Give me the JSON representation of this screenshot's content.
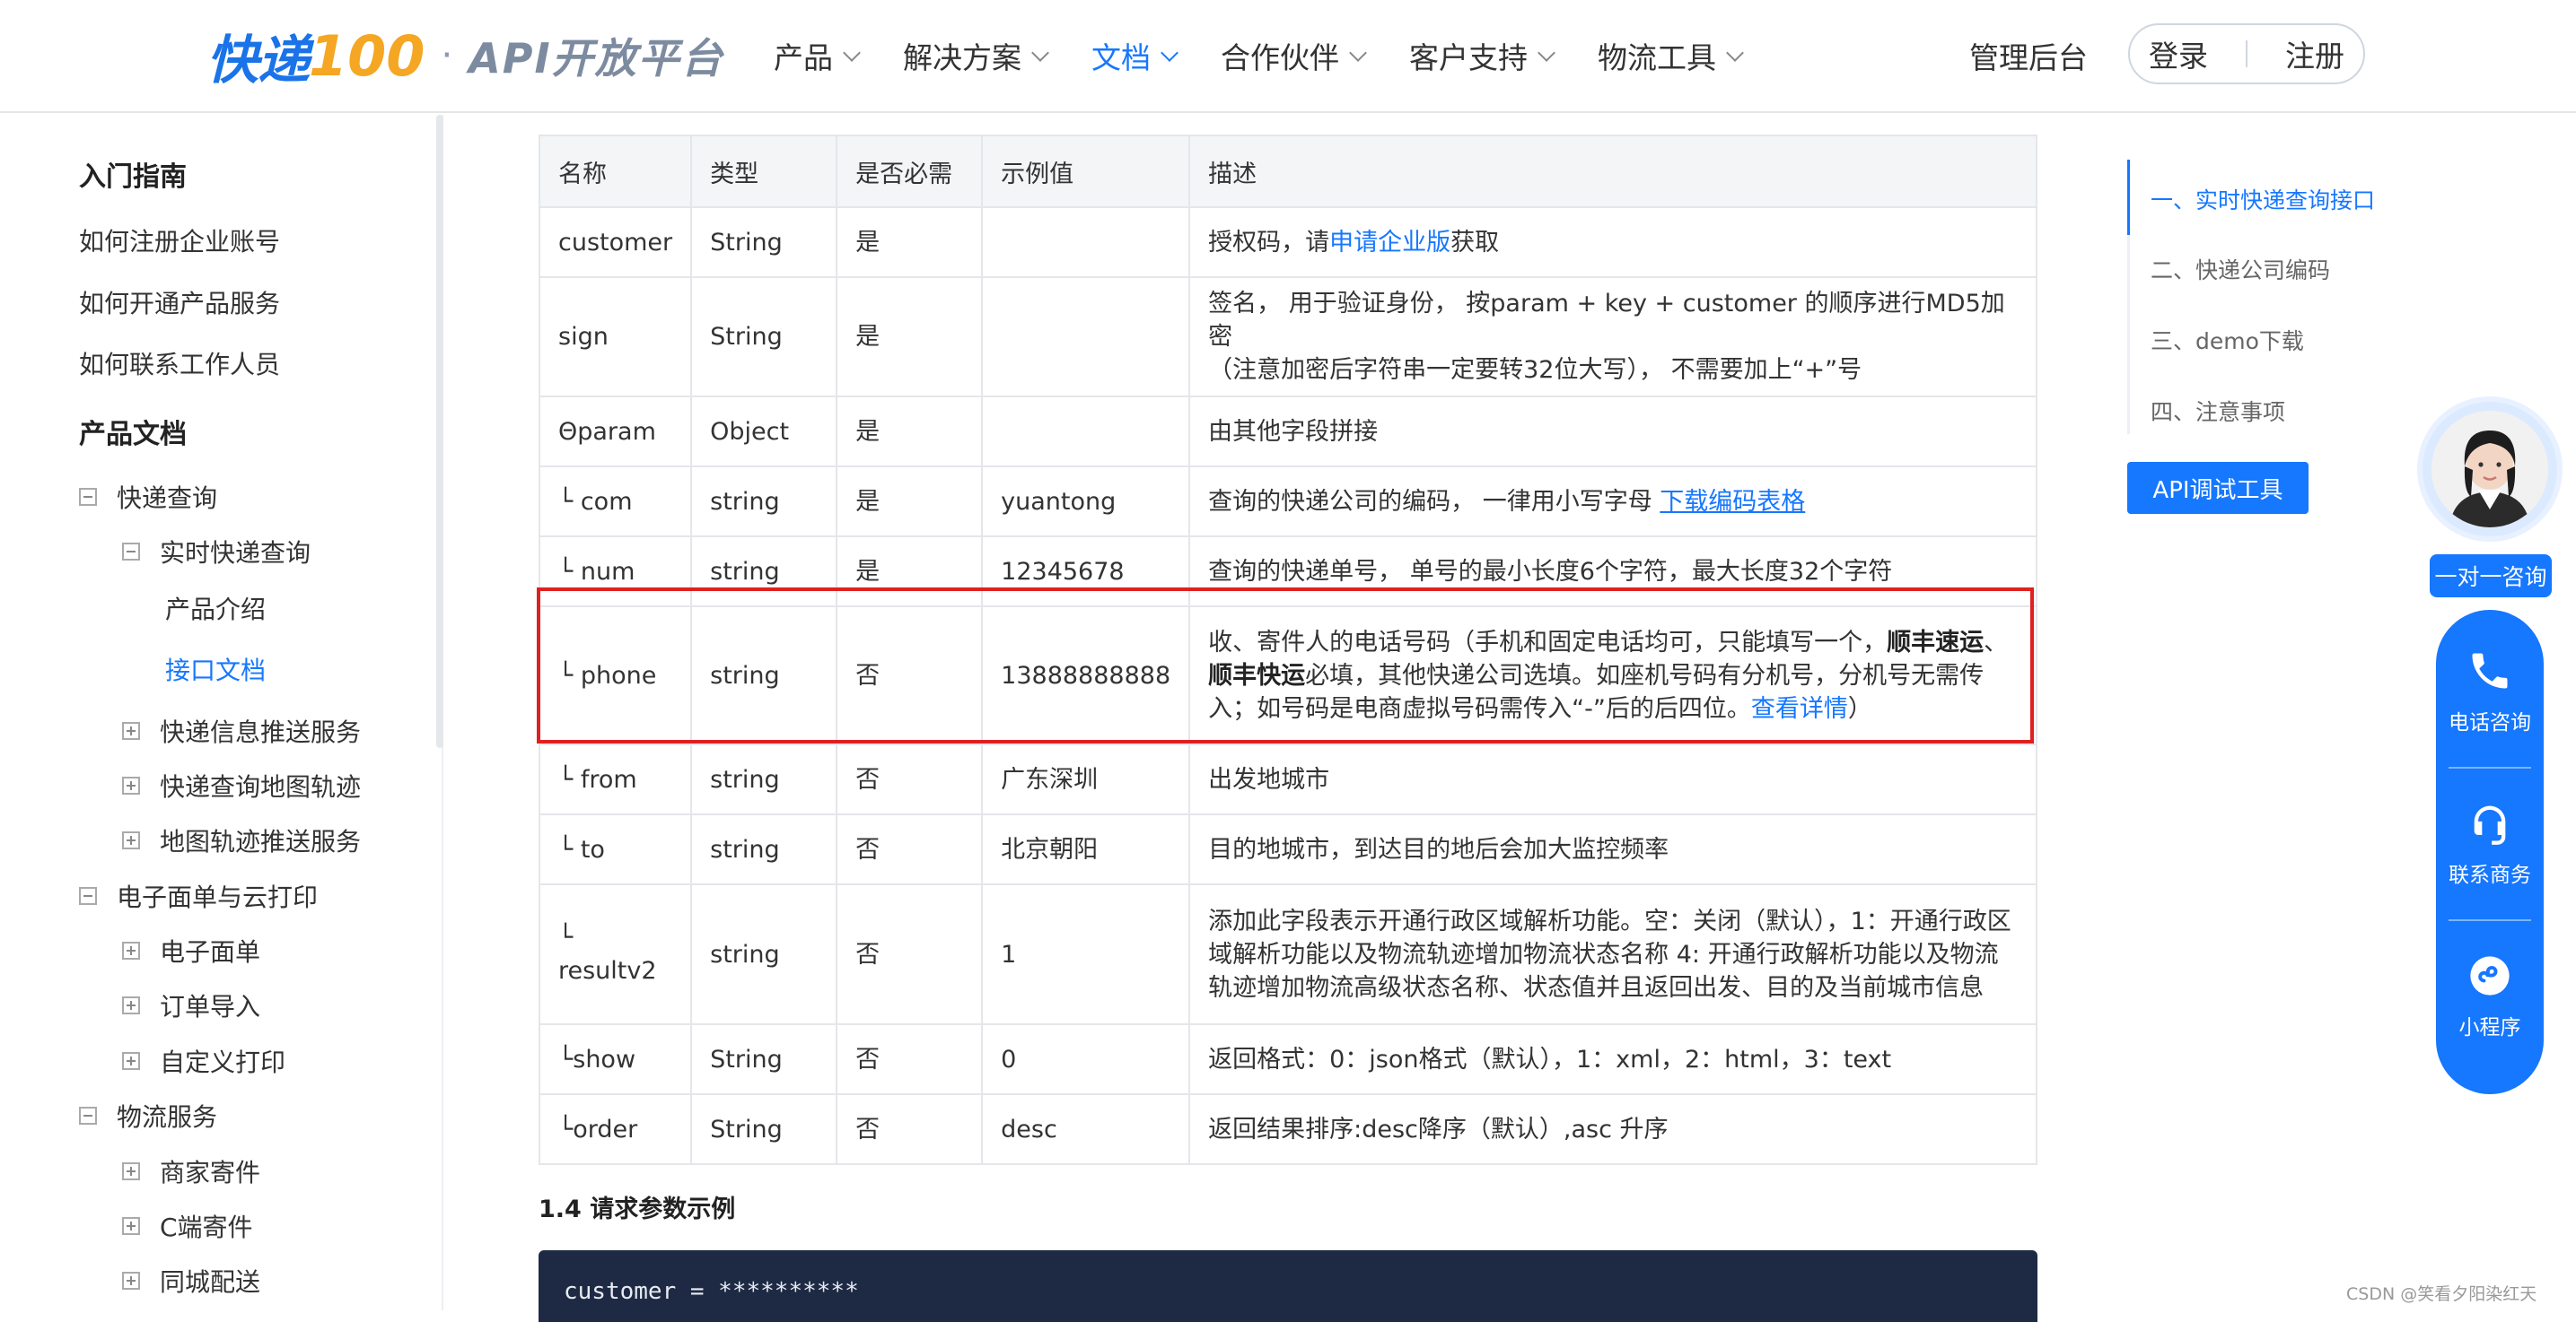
{
  "header": {
    "logo_main": "快递",
    "logo_num": "100",
    "logo_dot": "·",
    "logo_sub": "API开放平台",
    "nav": [
      {
        "label": "产品",
        "active": false
      },
      {
        "label": "解决方案",
        "active": false
      },
      {
        "label": "文档",
        "active": true
      },
      {
        "label": "合作伙伴",
        "active": false
      },
      {
        "label": "客户支持",
        "active": false
      },
      {
        "label": "物流工具",
        "active": false
      }
    ],
    "admin": "管理后台",
    "login": "登录",
    "register": "注册"
  },
  "sidebar": {
    "section1": "入门指南",
    "links": [
      "如何注册企业账号",
      "如何开通产品服务",
      "如何联系工作人员"
    ],
    "section2": "产品文档",
    "tree": {
      "g1": "快递查询",
      "g1_sub": "实时快递查询",
      "g1_leaf1": "产品介绍",
      "g1_leaf2": "接口文档",
      "g1_items": [
        "快递信息推送服务",
        "快递查询地图轨迹",
        "地图轨迹推送服务"
      ],
      "g2": "电子面单与云打印",
      "g2_items": [
        "电子面单",
        "订单导入",
        "自定义打印"
      ],
      "g3": "物流服务",
      "g3_items": [
        "商家寄件",
        "C端寄件",
        "同城配送"
      ]
    }
  },
  "table": {
    "headers": [
      "名称",
      "类型",
      "是否必需",
      "示例值",
      "描述"
    ],
    "rows": [
      {
        "name": "customer",
        "type": "String",
        "req": "是",
        "ex": "",
        "desc_pre": "授权码，请",
        "desc_link": "申请企业版",
        "desc_post": "获取"
      },
      {
        "name": "sign",
        "type": "String",
        "req": "是",
        "ex": "",
        "desc1": "签名， 用于验证身份， 按param + key + customer 的顺序进行MD5加密",
        "desc2": "（注意加密后字符串一定要转32位大写）， 不需要加上“+”号"
      },
      {
        "name": "Θparam",
        "type": "Object",
        "req": "是",
        "ex": "",
        "desc": "由其他字段拼接"
      },
      {
        "name": "└ com",
        "type": "string",
        "req": "是",
        "ex": "yuantong",
        "desc_pre": "查询的快递公司的编码， 一律用小写字母 ",
        "desc_link": "下载编码表格"
      },
      {
        "name": "└ num",
        "type": "string",
        "req": "是",
        "ex": "12345678",
        "desc": "查询的快递单号， 单号的最小长度6个字符，最大长度32个字符"
      },
      {
        "name": "└ phone",
        "type": "string",
        "req": "否",
        "ex": "13888888888",
        "desc_a": "收、寄件人的电话号码（手机和固定电话均可，只能填写一个，",
        "desc_b1": "顺丰速运",
        "desc_c": "、",
        "desc_b2": "顺丰快运",
        "desc_d": "必填，其他快递公司选填。如座机号码有分机号，分机号无需传入；如号码是电商虚拟号码需传入“-”后的后四位。",
        "desc_link": "查看详情",
        "desc_e": "）"
      },
      {
        "name": "└ from",
        "type": "string",
        "req": "否",
        "ex": "广东深圳",
        "desc": "出发地城市"
      },
      {
        "name": "└ to",
        "type": "string",
        "req": "否",
        "ex": "北京朝阳",
        "desc": "目的地城市，到达目的地后会加大监控频率"
      },
      {
        "name1": "└",
        "name2": "resultv2",
        "type": "string",
        "req": "否",
        "ex": "1",
        "desc": "添加此字段表示开通行政区域解析功能。空：关闭（默认），1：开通行政区域解析功能以及物流轨迹增加物流状态名称 4: 开通行政解析功能以及物流轨迹增加物流高级状态名称、状态值并且返回出发、目的及当前城市信息"
      },
      {
        "name": "└show",
        "type": "String",
        "req": "否",
        "ex": "0",
        "desc": "返回格式：0：json格式（默认），1：xml，2：html，3：text"
      },
      {
        "name": "└order",
        "type": "String",
        "req": "否",
        "ex": "desc",
        "desc": "返回结果排序:desc降序（默认）,asc 升序"
      }
    ]
  },
  "section_title": "1.4 请求参数示例",
  "code_line": "customer = **********",
  "toc": {
    "items": [
      "一、实时快递查询接口",
      "二、快递公司编码",
      "三、demo下载",
      "四、注意事项"
    ],
    "api_button": "API调试工具"
  },
  "float": {
    "consult": "一对一咨询",
    "phone": "电话咨询",
    "business": "联系商务",
    "miniapp": "小程序"
  },
  "watermark": "CSDN @笑看夕阳染红天",
  "colors": {
    "accent": "#1677ff",
    "highlight": "#e02020",
    "code_bg": "#1e2a44"
  }
}
